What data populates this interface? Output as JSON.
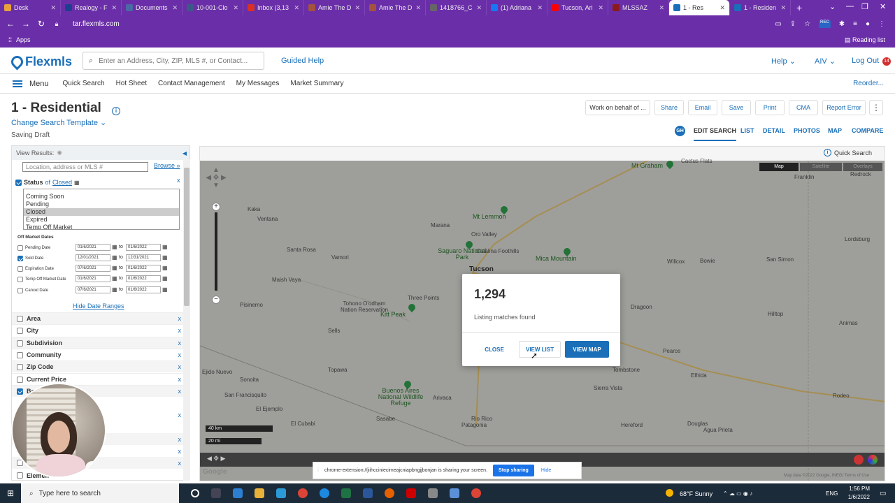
{
  "browser": {
    "tabs": [
      {
        "label": "Desk",
        "color": "#e9a23b"
      },
      {
        "label": "Realogy - F",
        "color": "#1d3f8f"
      },
      {
        "label": "Documents",
        "color": "#4a6aa5"
      },
      {
        "label": "10-001-Clo",
        "color": "#3b5b87"
      },
      {
        "label": "Inbox (3,13",
        "color": "#d93025"
      },
      {
        "label": "Amie The D",
        "color": "#a4533c"
      },
      {
        "label": "Amie The D",
        "color": "#a4533c"
      },
      {
        "label": "1418766_C",
        "color": "#666666"
      },
      {
        "label": "(1) Adriana",
        "color": "#1877f2"
      },
      {
        "label": "Tucson, Ari",
        "color": "#ff0000"
      },
      {
        "label": "MLSSAZ",
        "color": "#8b1a1a"
      },
      {
        "label": "1 - Res",
        "color": "#1a6fb8",
        "active": true
      },
      {
        "label": "1 - Residen",
        "color": "#1a6fb8"
      }
    ],
    "url": "tar.flexmls.com",
    "apps_label": "Apps",
    "reading_list": "Reading list"
  },
  "header": {
    "logo": "Flexmls",
    "search_placeholder": "Enter an Address, City, ZIP, MLS #, or Contact...",
    "guided_help": "Guided Help",
    "help": "Help",
    "user": "AIV",
    "logout": "Log Out",
    "notif_count": "14"
  },
  "nav": {
    "menu": "Menu",
    "items": [
      "Quick Search",
      "Hot Sheet",
      "Contact Management",
      "My Messages",
      "Market Summary"
    ],
    "reorder": "Reorder..."
  },
  "page": {
    "title": "1 - Residential",
    "template": "Change Search Template",
    "saving": "Saving Draft",
    "actions": [
      "Work on behalf of ...",
      "Share",
      "Email",
      "Save",
      "Print",
      "CMA",
      "Report Error"
    ],
    "gh": "GH",
    "view_tabs": [
      "EDIT SEARCH",
      "LIST",
      "DETAIL",
      "PHOTOS",
      "MAP",
      "COMPARE"
    ]
  },
  "left": {
    "view_results": "View Results:",
    "location_placeholder": "Location, address or MLS #",
    "browse": "Browse »",
    "status_label": "Status",
    "status_of": "of",
    "status_value": "Closed",
    "status_options": [
      "Coming Soon",
      "Pending",
      "Closed",
      "Expired",
      "Temp Off Market"
    ],
    "off_market_dates": "Off Market Dates",
    "dates": [
      {
        "label": "Pending Date",
        "from": "01/6/2021",
        "to": "01/6/2022",
        "checked": false
      },
      {
        "label": "Sold Date",
        "from": "12/01/2021",
        "to": "12/31/2021",
        "checked": true
      },
      {
        "label": "Expiration Date",
        "from": "07/6/2021",
        "to": "01/6/2022",
        "checked": false
      },
      {
        "label": "Temp Off Market Date",
        "from": "01/6/2021",
        "to": "01/6/2022",
        "checked": false
      },
      {
        "label": "Cancel Date",
        "from": "07/6/2021",
        "to": "01/6/2022",
        "checked": false
      }
    ],
    "to_word": "to",
    "hide_ranges": "Hide Date Ranges",
    "criteria": [
      "Area",
      "City",
      "Subdivision",
      "Community",
      "Zip Code",
      "Current Price",
      "Be"
    ],
    "last_item": "Elemen"
  },
  "map": {
    "quick_search": "Quick Search",
    "toggle": [
      "Map",
      "Satellite",
      "Overlays"
    ],
    "places": [
      {
        "name": "Mt Graham",
        "kind": "green"
      },
      {
        "name": "Cactus Flats"
      },
      {
        "name": "Franklin"
      },
      {
        "name": "Redrock"
      },
      {
        "name": "Kaka"
      },
      {
        "name": "Ventana"
      },
      {
        "name": "Mt Lemmon",
        "kind": "green"
      },
      {
        "name": "Marana"
      },
      {
        "name": "Oro Valley"
      },
      {
        "name": "Saguaro National Park",
        "kind": "green"
      },
      {
        "name": "Catalina Foothills"
      },
      {
        "name": "Mica Mountain",
        "kind": "green"
      },
      {
        "name": "Tucson",
        "kind": "big"
      },
      {
        "name": "Santa Rosa"
      },
      {
        "name": "Vamori"
      },
      {
        "name": "Maish Vaya"
      },
      {
        "name": "Pisinemo"
      },
      {
        "name": "Three Points"
      },
      {
        "name": "Kitt Peak",
        "kind": "green"
      },
      {
        "name": "Tohono O'odham Nation Reservation"
      },
      {
        "name": "Sells"
      },
      {
        "name": "Topawa"
      },
      {
        "name": "Sonoita"
      },
      {
        "name": "San Francisquito"
      },
      {
        "name": "El Ejemplo"
      },
      {
        "name": "Buenos Aires National Wildlife Refuge",
        "kind": "green"
      },
      {
        "name": "Arivaca"
      },
      {
        "name": "Sasabe"
      },
      {
        "name": "El Cubabi"
      },
      {
        "name": "Ejido Nuevo"
      },
      {
        "name": "Rio Rico"
      },
      {
        "name": "Patagonia"
      },
      {
        "name": "Willcox"
      },
      {
        "name": "Bowie"
      },
      {
        "name": "San Simon"
      },
      {
        "name": "Lordsburg"
      },
      {
        "name": "Dragoon"
      },
      {
        "name": "Benson"
      },
      {
        "name": "Hilltop"
      },
      {
        "name": "Animas"
      },
      {
        "name": "Tombstone"
      },
      {
        "name": "Elfrida"
      },
      {
        "name": "Sierra Vista"
      },
      {
        "name": "Hereford"
      },
      {
        "name": "Douglas"
      },
      {
        "name": "Pearce"
      },
      {
        "name": "Agua Prieta"
      },
      {
        "name": "Rodeo"
      }
    ],
    "scale_km": "40 km",
    "scale_mi": "20 mi",
    "google": "Google",
    "attrib": "Map data ©2022 Google, INEGI   Terms of Use"
  },
  "modal": {
    "count": "1,294",
    "subtitle": "Listing matches found",
    "close": "CLOSE",
    "view_list": "VIEW LIST",
    "view_map": "VIEW MAP"
  },
  "sharing": {
    "text": "chrome-extension://jiihcciniecimeajcniapbngjjbonjan is sharing your screen.",
    "stop": "Stop sharing",
    "hide": "Hide"
  },
  "taskbar": {
    "search": "Type here to search",
    "weather": "68°F  Sunny",
    "lang": "ENG",
    "time": "1:56 PM",
    "date": "1/6/2022"
  }
}
